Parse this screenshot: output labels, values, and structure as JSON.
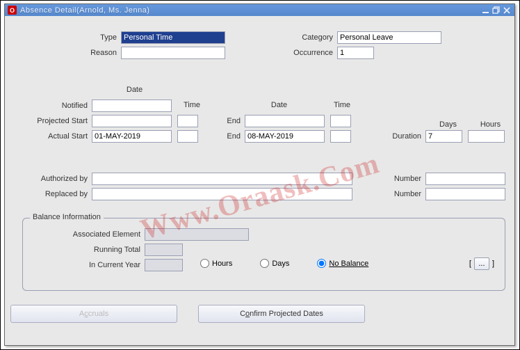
{
  "window": {
    "title": "Absence Detail(Arnold, Ms. Jenna)"
  },
  "header": {
    "type_label": "Type",
    "type_value": "Personal Time",
    "category_label": "Category",
    "category_value": "Personal Leave",
    "reason_label": "Reason",
    "reason_value": "",
    "occurrence_label": "Occurrence",
    "occurrence_value": "1"
  },
  "dates": {
    "date_col": "Date",
    "time_col": "Time",
    "notified_label": "Notified",
    "notified_date": "",
    "notified_time": "",
    "proj_start_label": "Projected Start",
    "proj_start_date": "",
    "proj_start_time": "",
    "proj_end_label": "End",
    "proj_end_date": "",
    "proj_end_time": "",
    "actual_start_label": "Actual Start",
    "actual_start_date": "01-MAY-2019",
    "actual_start_time": "",
    "actual_end_label": "End",
    "actual_end_date": "08-MAY-2019",
    "actual_end_time": "",
    "days_col": "Days",
    "hours_col": "Hours",
    "duration_label": "Duration",
    "days_value": "7",
    "hours_value": ""
  },
  "auth": {
    "authorized_by_label": "Authorized by",
    "authorized_by_value": "",
    "replaced_by_label": "Replaced by",
    "replaced_by_value": "",
    "number_label": "Number",
    "auth_number_value": "",
    "repl_number_value": ""
  },
  "balance": {
    "group_title": "Balance Information",
    "associated_element_label": "Associated Element",
    "associated_element_value": "",
    "running_total_label": "Running Total",
    "running_total_value": "",
    "in_current_year_label": "In Current Year",
    "in_current_year_value": "",
    "hours_radio": "Hours",
    "days_radio": "Days",
    "no_balance_radio": "No Balance",
    "details_btn": "..."
  },
  "buttons": {
    "accruals": "Accruals",
    "confirm": "Confirm Projected Dates"
  },
  "watermark": "Www.Oraask.Com"
}
